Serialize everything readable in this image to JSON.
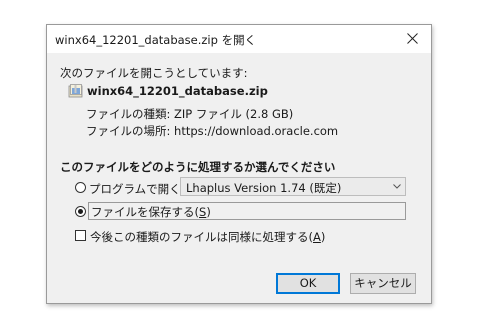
{
  "window": {
    "title": "winx64_12201_database.zip を開く"
  },
  "intro_text": "次のファイルを開こうとしています:",
  "file": {
    "name": "winx64_12201_database.zip",
    "type_label": "ファイルの種類:",
    "type_value": "ZIP ファイル (2.8 GB)",
    "location_label": "ファイルの場所:",
    "location_value": "https://download.oracle.com"
  },
  "question": "このファイルをどのように処理するか選んでください",
  "options": {
    "open_with_label": "プログラムで開く(",
    "open_with_key": "O",
    "open_with_suffix": "):",
    "open_with_app": "Lhaplus Version 1.74 (既定)",
    "save_label": "ファイルを保存する(",
    "save_key": "S",
    "save_suffix": ")",
    "selected": "save",
    "remember_label": "今後この種類のファイルは同様に処理する(",
    "remember_key": "A",
    "remember_suffix": ")",
    "remember_checked": false
  },
  "buttons": {
    "ok": "OK",
    "cancel": "キャンセル"
  },
  "colors": {
    "dialog_bg": "#f0f0f0",
    "default_button_border": "#0078d7"
  },
  "icons": {
    "close": "close-icon",
    "file": "zip-file-icon",
    "dropdown": "chevron-down-icon"
  }
}
